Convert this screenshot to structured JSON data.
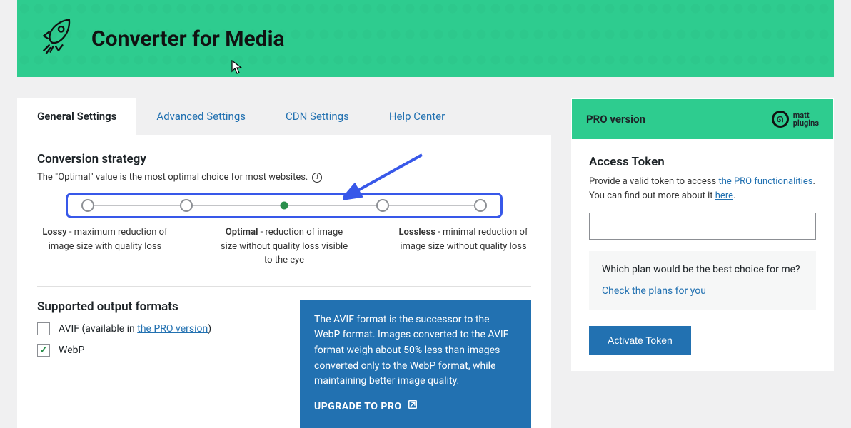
{
  "banner": {
    "title": "Converter for Media"
  },
  "tabs": [
    {
      "label": "General Settings",
      "active": true
    },
    {
      "label": "Advanced Settings",
      "active": false
    },
    {
      "label": "CDN Settings",
      "active": false
    },
    {
      "label": "Help Center",
      "active": false
    }
  ],
  "conversion": {
    "heading": "Conversion strategy",
    "notice": "The \"Optimal\" value is the most optimal choice for most websites.",
    "selected_index": 2,
    "stops": 5,
    "labels": {
      "lossy_title": "Lossy",
      "lossy_desc": " - maximum reduction of image size with quality loss",
      "optimal_title": "Optimal",
      "optimal_desc": " - reduction of image size without quality loss visible to the eye",
      "lossless_title": "Lossless",
      "lossless_desc": " - minimal reduction of image size without quality loss"
    }
  },
  "formats": {
    "heading": "Supported output formats",
    "avif_prefix": "AVIF (available in ",
    "avif_link": "the PRO version",
    "avif_suffix": ")",
    "webp_label": "WebP",
    "avif_checked": false,
    "webp_checked": true
  },
  "promo": {
    "text": "The AVIF format is the successor to the WebP format. Images converted to the AVIF format weigh about 50% less than images converted only to the WebP format, while maintaining better image quality.",
    "cta": "UPGRADE TO PRO"
  },
  "pro": {
    "header": "PRO version",
    "logo_small": "matt",
    "logo_sub": "plugins",
    "token_heading": "Access Token",
    "desc_prefix": "Provide a valid token to access ",
    "desc_link": "the PRO functionalities",
    "desc_suffix": ". You can find out more about it ",
    "desc_here": "here",
    "desc_end": ".",
    "plan_q": "Which plan would be the best choice for me?",
    "plan_link": "Check the plans for you",
    "activate": "Activate Token",
    "token_value": ""
  }
}
